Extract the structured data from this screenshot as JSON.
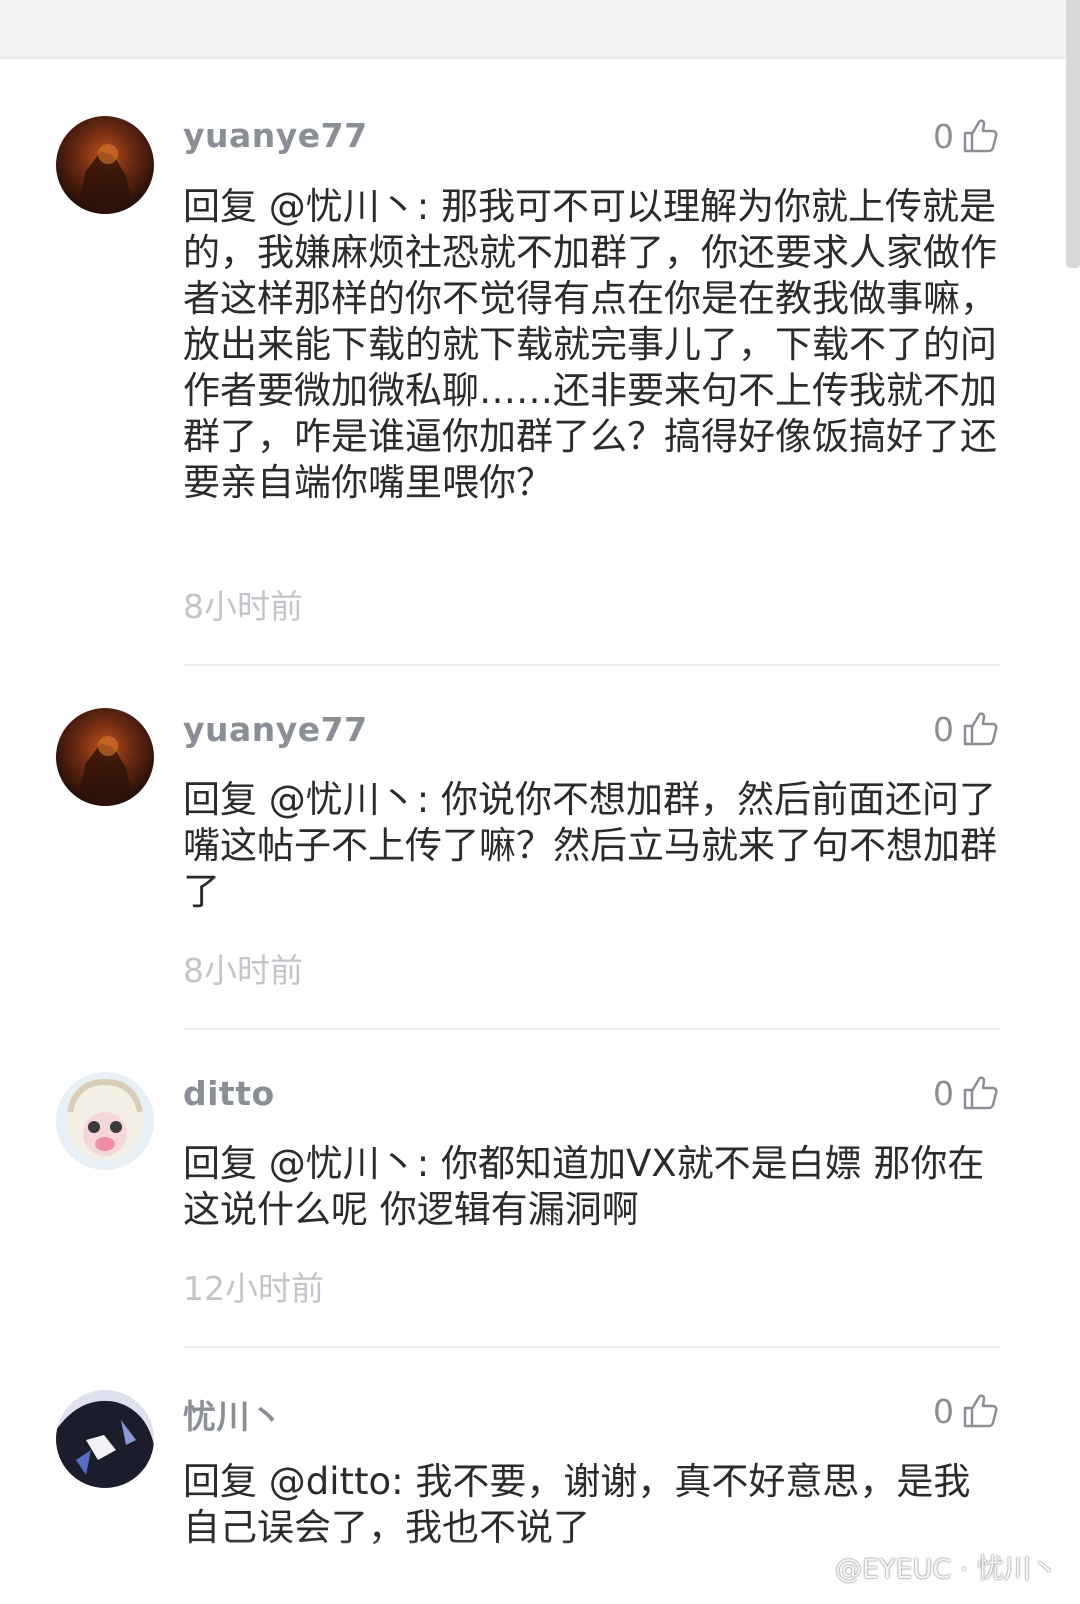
{
  "comments": [
    {
      "username": "yuanye77",
      "likes": "0",
      "text": "回复 @忧川丶: 那我可不可以理解为你就上传就是的，我嫌麻烦社恐就不加群了，你还要求人家做作者这样那样的你不觉得有点在你是在教我做事嘛，放出来能下载的就下载就完事儿了，下载不了的问作者要微加微私聊……还非要来句不上传我就不加群了，咋是谁逼你加群了么？搞得好像饭搞好了还要亲自端你嘴里喂你？",
      "time": "8小时前"
    },
    {
      "username": "yuanye77",
      "likes": "0",
      "text": "回复 @忧川丶: 你说你不想加群，然后前面还问了嘴这帖子不上传了嘛？然后立马就来了句不想加群了",
      "time": "8小时前"
    },
    {
      "username": "ditto",
      "likes": "0",
      "text": "回复 @忧川丶: 你都知道加VX就不是白嫖 那你在这说什么呢 你逻辑有漏洞啊",
      "time": "12小时前"
    },
    {
      "username": "忧川丶",
      "likes": "0",
      "text": "回复 @ditto: 我不要，谢谢，真不好意思，是我自己误会了，我也不说了",
      "time": ""
    }
  ],
  "watermark": "@EYEUC · 忧川丶",
  "icons": {
    "like": "thumbs-up-icon"
  },
  "colors": {
    "username": "#8a8f96",
    "body": "#2b2b2b",
    "time": "#c2c5ca",
    "top_bar": "#f1f2f4"
  }
}
